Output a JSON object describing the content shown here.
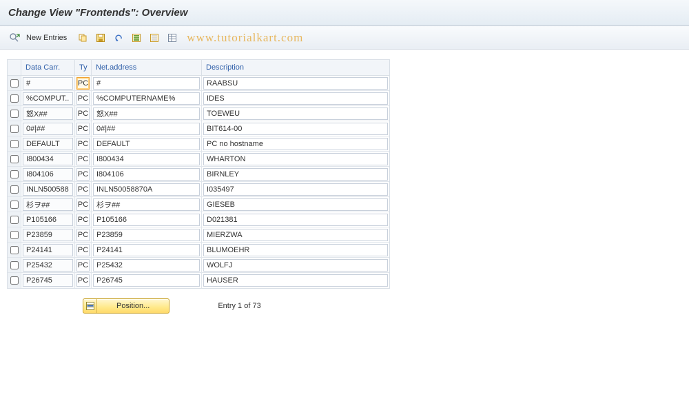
{
  "title": "Change View \"Frontends\": Overview",
  "toolbar": {
    "new_entries": "New Entries"
  },
  "watermark": "www.tutorialkart.com",
  "columns": {
    "data_carr": "Data Carr.",
    "ty": "Ty",
    "net": "Net.address",
    "desc": "Description"
  },
  "rows": [
    {
      "carr": "#",
      "ty": "PC",
      "net": "#",
      "desc": "RAABSU",
      "ty_active": true
    },
    {
      "carr": "%COMPUT..",
      "ty": "PC",
      "net": "%COMPUTERNAME%",
      "desc": "IDES"
    },
    {
      "carr": "怒X##",
      "ty": "PC",
      "net": "怒X##",
      "desc": "TOEWEU"
    },
    {
      "carr": "0#|##",
      "ty": "PC",
      "net": "0#|##",
      "desc": "BIT614-00"
    },
    {
      "carr": "DEFAULT",
      "ty": "PC",
      "net": "DEFAULT",
      "desc": "PC no hostname"
    },
    {
      "carr": "I800434",
      "ty": "PC",
      "net": "I800434",
      "desc": "WHARTON"
    },
    {
      "carr": "I804106",
      "ty": "PC",
      "net": "I804106",
      "desc": "BIRNLEY"
    },
    {
      "carr": "INLN500588",
      "ty": "PC",
      "net": "INLN50058870A",
      "desc": "I035497"
    },
    {
      "carr": "杉ヲ##",
      "ty": "PC",
      "net": "杉ヲ##",
      "desc": "GIESEB"
    },
    {
      "carr": "P105166",
      "ty": "PC",
      "net": "P105166",
      "desc": "D021381"
    },
    {
      "carr": "P23859",
      "ty": "PC",
      "net": "P23859",
      "desc": "MIERZWA"
    },
    {
      "carr": "P24141",
      "ty": "PC",
      "net": "P24141",
      "desc": "BLUMOEHR"
    },
    {
      "carr": "P25432",
      "ty": "PC",
      "net": "P25432",
      "desc": "WOLFJ"
    },
    {
      "carr": "P26745",
      "ty": "PC",
      "net": "P26745",
      "desc": "HAUSER"
    }
  ],
  "position_label": "Position...",
  "entry_text": "Entry 1 of 73"
}
